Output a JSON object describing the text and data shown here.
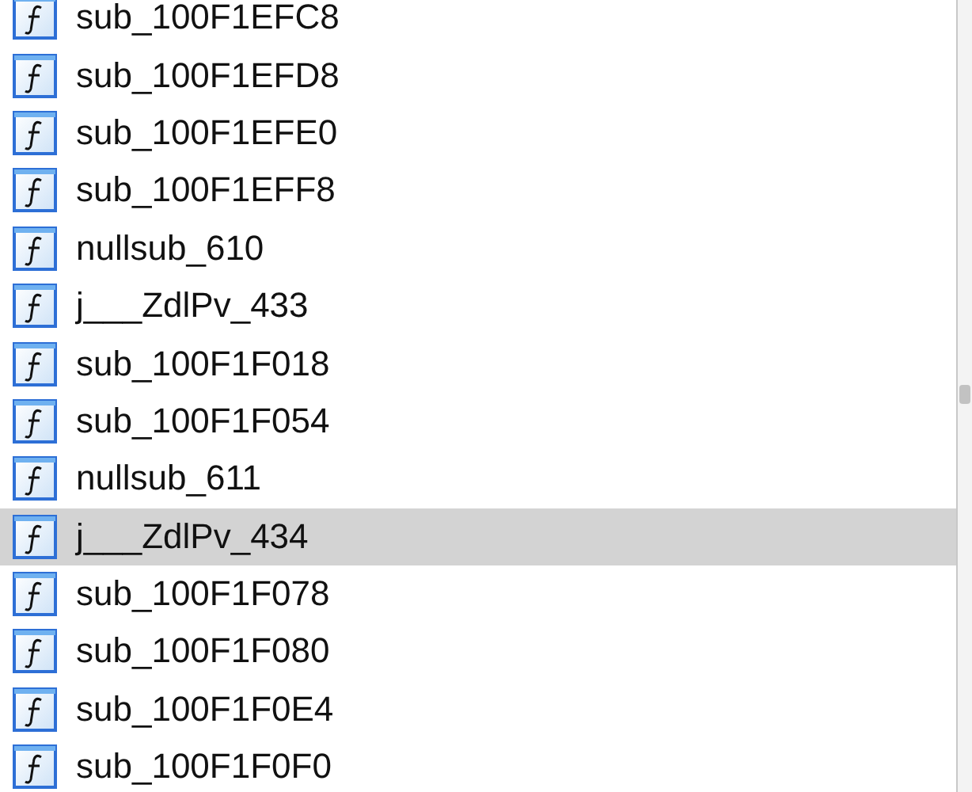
{
  "functions": [
    {
      "name": "sub_100F1EFC8",
      "selected": false
    },
    {
      "name": "sub_100F1EFD8",
      "selected": false
    },
    {
      "name": "sub_100F1EFE0",
      "selected": false
    },
    {
      "name": "sub_100F1EFF8",
      "selected": false
    },
    {
      "name": "nullsub_610",
      "selected": false
    },
    {
      "name": "j___ZdlPv_433",
      "selected": false
    },
    {
      "name": "sub_100F1F018",
      "selected": false
    },
    {
      "name": "sub_100F1F054",
      "selected": false
    },
    {
      "name": "nullsub_611",
      "selected": false
    },
    {
      "name": "j___ZdlPv_434",
      "selected": true
    },
    {
      "name": "sub_100F1F078",
      "selected": false
    },
    {
      "name": "sub_100F1F080",
      "selected": false
    },
    {
      "name": "sub_100F1F0E4",
      "selected": false
    },
    {
      "name": "sub_100F1F0F0",
      "selected": false
    }
  ]
}
